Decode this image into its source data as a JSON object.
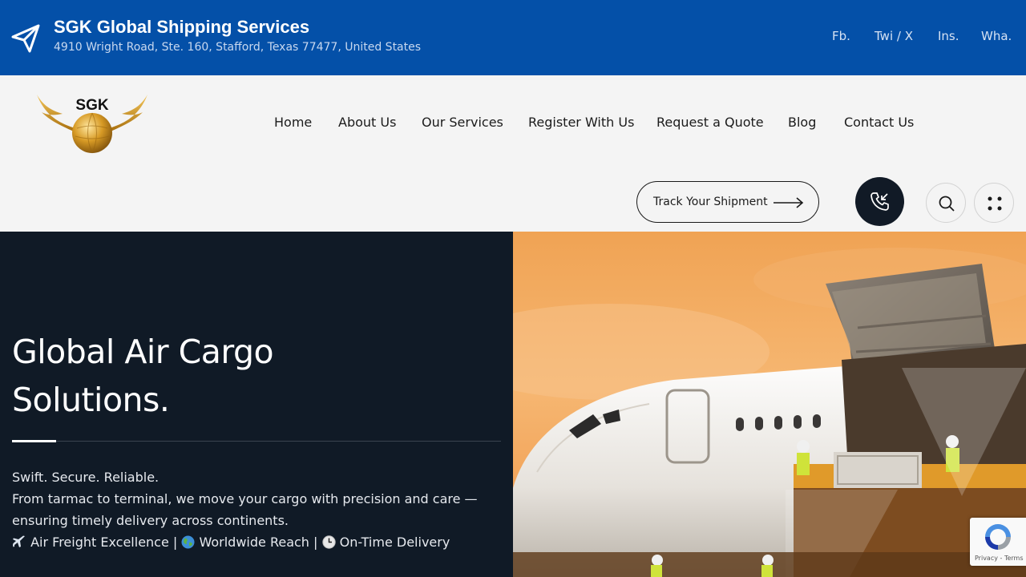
{
  "topbar": {
    "brand": "SGK Global Shipping Services",
    "address": "4910 Wright Road, Ste. 160, Stafford, Texas 77477, United States",
    "social": [
      "Fb.",
      "Twi / X",
      "Ins.",
      "Wha."
    ]
  },
  "logo": {
    "text": "SGK"
  },
  "nav": {
    "items": [
      "Home",
      "About Us",
      "Our Services",
      "Register With Us",
      "Request a Quote",
      "Blog",
      "Contact Us"
    ],
    "track_label": "Track Your Shipment"
  },
  "hero": {
    "title_line1": "Global Air Cargo",
    "title_line2": "Solutions.",
    "tagline": "Swift. Secure. Reliable.",
    "desc_line1": "From tarmac to terminal, we move your cargo with precision and care —",
    "desc_line2": "ensuring timely delivery across continents.",
    "features": [
      {
        "icon": "airplane-icon",
        "label": "Air Freight Excellence"
      },
      {
        "icon": "globe-icon",
        "label": "Worldwide Reach"
      },
      {
        "icon": "clock-icon",
        "label": "On-Time Delivery"
      }
    ],
    "separator": "|"
  },
  "recaptcha": {
    "terms": "Privacy - Terms"
  },
  "colors": {
    "topbar": "#0450a8",
    "navbar": "#f4f4f4",
    "hero_dark": "#101a26",
    "gold": "#d4a12a"
  }
}
